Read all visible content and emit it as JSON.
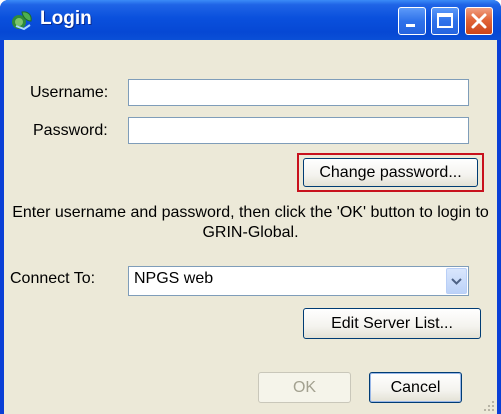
{
  "window": {
    "title": "Login"
  },
  "form": {
    "username_label": "Username:",
    "username_value": "",
    "password_label": "Password:",
    "password_value": "",
    "change_password_label": "Change password...",
    "message": "Enter username and password, then click the 'OK' button to login to GRIN-Global.",
    "connect_label": "Connect To:",
    "connect_value": "NPGS web",
    "edit_server_label": "Edit Server List...",
    "ok_label": "OK",
    "cancel_label": "Cancel"
  },
  "icons": {
    "app": "grin-global-app-icon",
    "minimize": "minimize-icon",
    "maximize": "maximize-icon",
    "close": "close-icon",
    "dropdown": "chevron-down-icon"
  },
  "colors": {
    "titlebar": "#0a50dd",
    "client_background": "#ece9d8",
    "highlight_border": "#c8111d"
  }
}
